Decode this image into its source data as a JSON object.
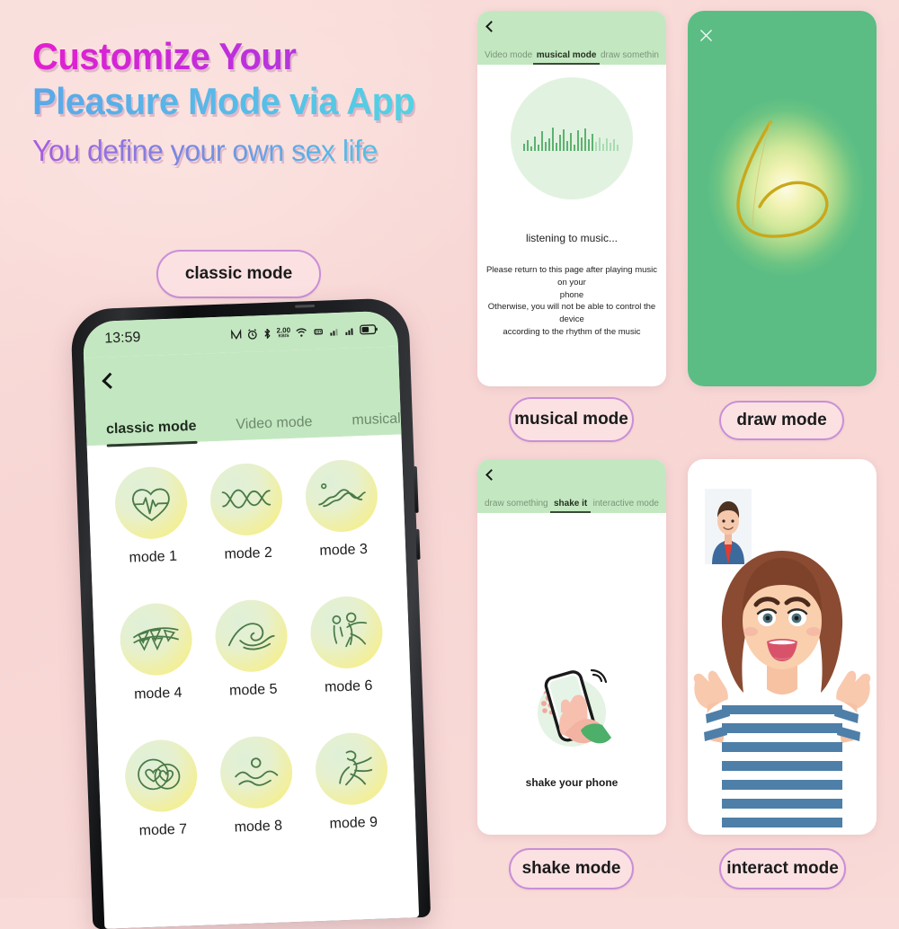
{
  "background_color": "#f9dcd9",
  "headline": {
    "line1": "Customize Your",
    "line2": "Pleasure Mode via App",
    "line3": "You define your own sex life",
    "color_line1": "#d62bd2",
    "color_line2": "#56b4e8",
    "color_line3": "#8f6ce4"
  },
  "labels": {
    "classic": "classic mode",
    "musical": "musical mode",
    "draw": "draw mode",
    "shake": "shake mode",
    "interact": "interact mode",
    "pill_border_color": "#c98fd6",
    "pill_fill_color": "#fbe1e2"
  },
  "phone": {
    "status_bar": {
      "time": "13:59",
      "icons": [
        "nfc-icon",
        "alarm-icon",
        "bluetooth-icon",
        "data-speed-icon",
        "wifi-icon",
        "vibrate-icon",
        "signal-1-icon",
        "signal-2-icon",
        "battery-icon"
      ],
      "data_speed": "2.00",
      "data_speed_unit": "KB/S",
      "background_color": "#c3e8c1"
    },
    "back_label": "back",
    "tabs": [
      {
        "label": "classic mode",
        "active": true
      },
      {
        "label": "Video mode",
        "active": false
      },
      {
        "label": "musical mode",
        "active": false
      }
    ],
    "modes": [
      {
        "label": "mode 1",
        "icon": "heartbeat-icon"
      },
      {
        "label": "mode 2",
        "icon": "wave-crossing-icon"
      },
      {
        "label": "mode 3",
        "icon": "ripple-wave-icon"
      },
      {
        "label": "mode 4",
        "icon": "bunting-flags-icon"
      },
      {
        "label": "mode 5",
        "icon": "ocean-wave-icon"
      },
      {
        "label": "mode 6",
        "icon": "dancing-people-icon"
      },
      {
        "label": "mode 7",
        "icon": "double-heart-icon"
      },
      {
        "label": "mode 8",
        "icon": "swimmer-icon"
      },
      {
        "label": "mode 9",
        "icon": "runner-icon"
      }
    ]
  },
  "musical_card": {
    "tabs": [
      {
        "label": "Video mode",
        "active": false
      },
      {
        "label": "musical mode",
        "active": true
      },
      {
        "label": "draw somethin",
        "active": false
      }
    ],
    "status_text": "listening to music...",
    "note_line1": "Please return to this page after playing music on your",
    "note_line2": "phone",
    "note_line3": "Otherwise, you will not be able to control the device",
    "note_line4": "according to the rhythm of the music",
    "waveform_icon": "audio-waveform-icon"
  },
  "draw_card": {
    "close_icon": "close-x-icon",
    "canvas_glow_color": "#fdfce8",
    "canvas_edge_color": "#5bbd84",
    "stroke_color": "#c9a81b"
  },
  "shake_card": {
    "tabs": [
      {
        "label": "draw something",
        "active": false
      },
      {
        "label": "shake it",
        "active": true
      },
      {
        "label": "interactive mode",
        "active": false
      }
    ],
    "caption": "shake your phone",
    "illustration_icon": "hand-shaking-phone-icon"
  },
  "interact_card": {
    "thumbnail_icon": "male-avatar-thumbnail",
    "main_icon": "female-avatar-video"
  }
}
